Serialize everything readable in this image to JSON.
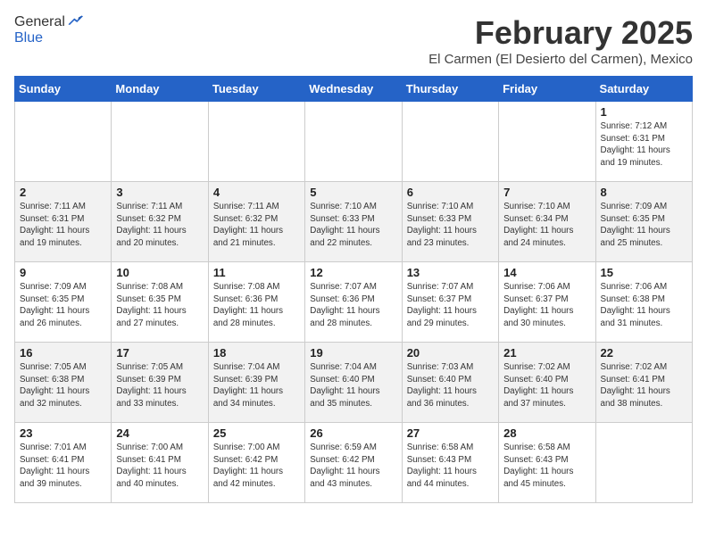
{
  "header": {
    "logo_general": "General",
    "logo_blue": "Blue",
    "title": "February 2025",
    "subtitle": "El Carmen (El Desierto del Carmen), Mexico"
  },
  "weekdays": [
    "Sunday",
    "Monday",
    "Tuesday",
    "Wednesday",
    "Thursday",
    "Friday",
    "Saturday"
  ],
  "weeks": [
    [
      {
        "day": "",
        "detail": ""
      },
      {
        "day": "",
        "detail": ""
      },
      {
        "day": "",
        "detail": ""
      },
      {
        "day": "",
        "detail": ""
      },
      {
        "day": "",
        "detail": ""
      },
      {
        "day": "",
        "detail": ""
      },
      {
        "day": "1",
        "detail": "Sunrise: 7:12 AM\nSunset: 6:31 PM\nDaylight: 11 hours\nand 19 minutes."
      }
    ],
    [
      {
        "day": "2",
        "detail": "Sunrise: 7:11 AM\nSunset: 6:31 PM\nDaylight: 11 hours\nand 19 minutes."
      },
      {
        "day": "3",
        "detail": "Sunrise: 7:11 AM\nSunset: 6:32 PM\nDaylight: 11 hours\nand 20 minutes."
      },
      {
        "day": "4",
        "detail": "Sunrise: 7:11 AM\nSunset: 6:32 PM\nDaylight: 11 hours\nand 21 minutes."
      },
      {
        "day": "5",
        "detail": "Sunrise: 7:10 AM\nSunset: 6:33 PM\nDaylight: 11 hours\nand 22 minutes."
      },
      {
        "day": "6",
        "detail": "Sunrise: 7:10 AM\nSunset: 6:33 PM\nDaylight: 11 hours\nand 23 minutes."
      },
      {
        "day": "7",
        "detail": "Sunrise: 7:10 AM\nSunset: 6:34 PM\nDaylight: 11 hours\nand 24 minutes."
      },
      {
        "day": "8",
        "detail": "Sunrise: 7:09 AM\nSunset: 6:35 PM\nDaylight: 11 hours\nand 25 minutes."
      }
    ],
    [
      {
        "day": "9",
        "detail": "Sunrise: 7:09 AM\nSunset: 6:35 PM\nDaylight: 11 hours\nand 26 minutes."
      },
      {
        "day": "10",
        "detail": "Sunrise: 7:08 AM\nSunset: 6:35 PM\nDaylight: 11 hours\nand 27 minutes."
      },
      {
        "day": "11",
        "detail": "Sunrise: 7:08 AM\nSunset: 6:36 PM\nDaylight: 11 hours\nand 28 minutes."
      },
      {
        "day": "12",
        "detail": "Sunrise: 7:07 AM\nSunset: 6:36 PM\nDaylight: 11 hours\nand 28 minutes."
      },
      {
        "day": "13",
        "detail": "Sunrise: 7:07 AM\nSunset: 6:37 PM\nDaylight: 11 hours\nand 29 minutes."
      },
      {
        "day": "14",
        "detail": "Sunrise: 7:06 AM\nSunset: 6:37 PM\nDaylight: 11 hours\nand 30 minutes."
      },
      {
        "day": "15",
        "detail": "Sunrise: 7:06 AM\nSunset: 6:38 PM\nDaylight: 11 hours\nand 31 minutes."
      }
    ],
    [
      {
        "day": "16",
        "detail": "Sunrise: 7:05 AM\nSunset: 6:38 PM\nDaylight: 11 hours\nand 32 minutes."
      },
      {
        "day": "17",
        "detail": "Sunrise: 7:05 AM\nSunset: 6:39 PM\nDaylight: 11 hours\nand 33 minutes."
      },
      {
        "day": "18",
        "detail": "Sunrise: 7:04 AM\nSunset: 6:39 PM\nDaylight: 11 hours\nand 34 minutes."
      },
      {
        "day": "19",
        "detail": "Sunrise: 7:04 AM\nSunset: 6:40 PM\nDaylight: 11 hours\nand 35 minutes."
      },
      {
        "day": "20",
        "detail": "Sunrise: 7:03 AM\nSunset: 6:40 PM\nDaylight: 11 hours\nand 36 minutes."
      },
      {
        "day": "21",
        "detail": "Sunrise: 7:02 AM\nSunset: 6:40 PM\nDaylight: 11 hours\nand 37 minutes."
      },
      {
        "day": "22",
        "detail": "Sunrise: 7:02 AM\nSunset: 6:41 PM\nDaylight: 11 hours\nand 38 minutes."
      }
    ],
    [
      {
        "day": "23",
        "detail": "Sunrise: 7:01 AM\nSunset: 6:41 PM\nDaylight: 11 hours\nand 39 minutes."
      },
      {
        "day": "24",
        "detail": "Sunrise: 7:00 AM\nSunset: 6:41 PM\nDaylight: 11 hours\nand 40 minutes."
      },
      {
        "day": "25",
        "detail": "Sunrise: 7:00 AM\nSunset: 6:42 PM\nDaylight: 11 hours\nand 42 minutes."
      },
      {
        "day": "26",
        "detail": "Sunrise: 6:59 AM\nSunset: 6:42 PM\nDaylight: 11 hours\nand 43 minutes."
      },
      {
        "day": "27",
        "detail": "Sunrise: 6:58 AM\nSunset: 6:43 PM\nDaylight: 11 hours\nand 44 minutes."
      },
      {
        "day": "28",
        "detail": "Sunrise: 6:58 AM\nSunset: 6:43 PM\nDaylight: 11 hours\nand 45 minutes."
      },
      {
        "day": "",
        "detail": ""
      }
    ]
  ]
}
